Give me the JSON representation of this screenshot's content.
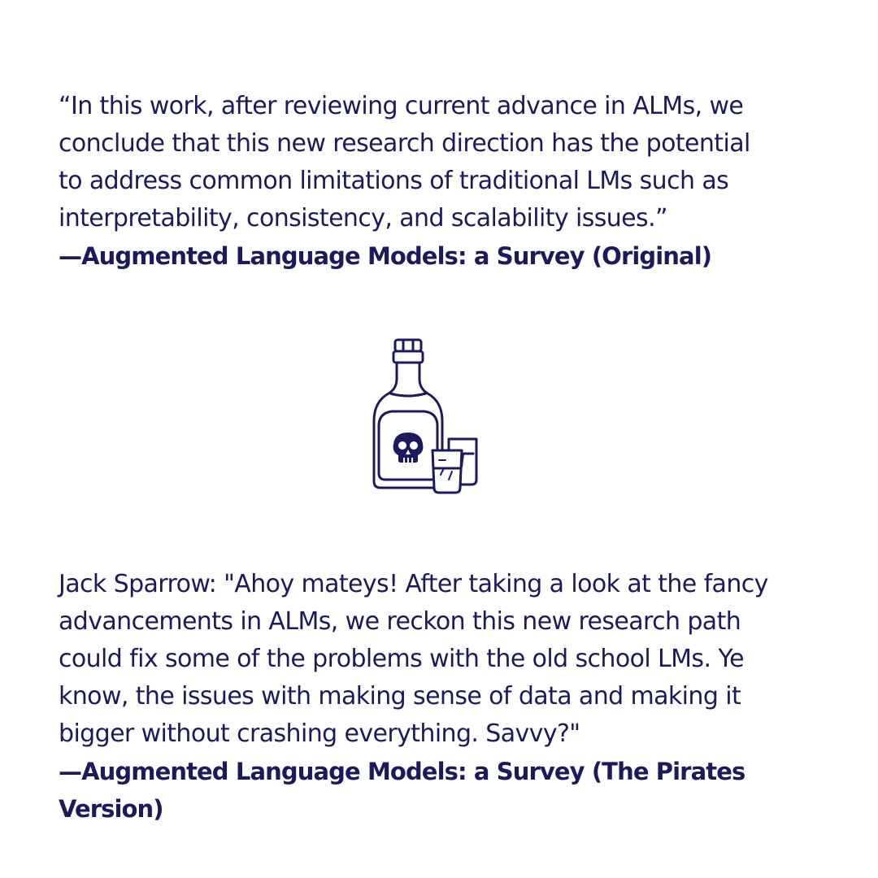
{
  "original": {
    "quote": "“In this work, after reviewing current advance in ALMs, we\nconclude that this new research direction has the potential\nto address common limitations of traditional LMs such as\ninterpretability, consistency, and scalability issues.”",
    "attribution": "—Augmented Language Models: a Survey (Original)"
  },
  "illustration": {
    "icon": "rum-bottle-with-skull-and-glasses-icon",
    "color": "#1c1a5c"
  },
  "pirate": {
    "quote": "Jack Sparrow: \"Ahoy mateys! After taking a look at the fancy\nadvancements in ALMs, we reckon this new research path\ncould fix some of the problems with the old school LMs. Ye\nknow, the issues with making sense of data and making it\nbigger without crashing everything. Savvy?\"",
    "attribution": "—Augmented Language Models: a Survey (The Pirates Version)"
  }
}
